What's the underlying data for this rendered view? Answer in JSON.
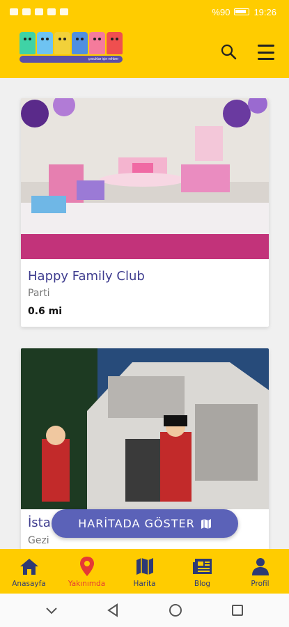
{
  "status_bar": {
    "battery_text": "%90",
    "time": "19:26"
  },
  "header": {
    "logo_text": "ATTAYA",
    "logo_tagline": "çocuklar için rehber"
  },
  "places": [
    {
      "title": "Happy Family Club",
      "category": "Parti",
      "distance": "0.6 mi"
    },
    {
      "title": "İsta",
      "category": "Gezi"
    }
  ],
  "map_button": {
    "label": "HARİTADA GÖSTER"
  },
  "bottom_nav": [
    {
      "label": "Anasayfa"
    },
    {
      "label": "Yakınımda"
    },
    {
      "label": "Harita"
    },
    {
      "label": "Blog"
    },
    {
      "label": "Profil"
    }
  ],
  "colors": {
    "brand_yellow": "#ffcc00",
    "primary_purple": "#5b62b8",
    "nav_text": "#2e3a74",
    "active_red": "#e53935"
  }
}
